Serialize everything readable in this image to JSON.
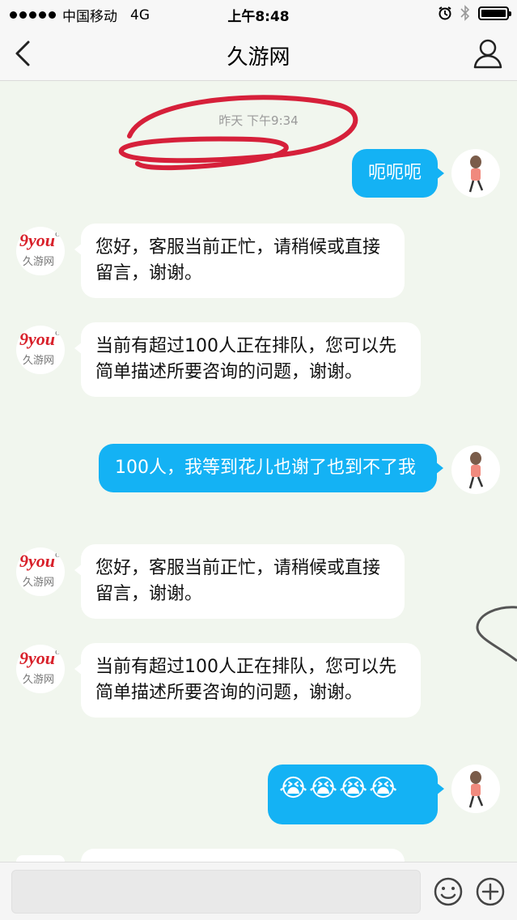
{
  "status_bar": {
    "carrier": "中国移动",
    "network": "4G",
    "time": "上午8:48"
  },
  "header": {
    "title": "久游网"
  },
  "chat": {
    "timestamp": "昨天 下午9:34",
    "service_logo_text": "9you",
    "service_logo_sub": "COM",
    "service_name": "久游网",
    "messages": [
      {
        "from": "user",
        "text": "呃呃呃"
      },
      {
        "from": "service",
        "text": "您好，客服当前正忙，请稍候或直接留言，谢谢。"
      },
      {
        "from": "service",
        "text": "当前有超过100人正在排队，您可以先简单描述所要咨询的问题，谢谢。"
      },
      {
        "from": "user",
        "text": "100人，我等到花儿也谢了也到不了我"
      },
      {
        "from": "service",
        "text": "您好，客服当前正忙，请稍候或直接留言，谢谢。"
      },
      {
        "from": "service",
        "text": "当前有超过100人正在排队，您可以先简单描述所要咨询的问题，谢谢。"
      },
      {
        "from": "user",
        "text": "😭😭😭😭"
      }
    ]
  },
  "colors": {
    "outgoing_bubble": "#14b2f4",
    "incoming_bubble": "#ffffff",
    "background": "#f1f6ee",
    "annotation": "#d6203a"
  },
  "icons": {
    "back": "chevron-left-icon",
    "profile": "person-icon",
    "emoji": "smile-icon",
    "more": "plus-circle-icon"
  }
}
